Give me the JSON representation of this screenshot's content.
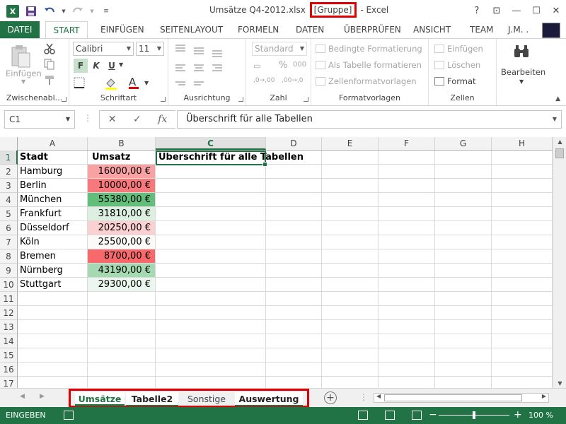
{
  "window": {
    "filename": "Umsätze Q4-2012.xlsx",
    "group_tag": "[Gruppe]",
    "app_suffix": "- Excel",
    "help": "?",
    "restore": "⊡",
    "minimize": "—",
    "maximize": "☐",
    "close": "✕"
  },
  "ribbon_tabs": [
    "DATEI",
    "START",
    "EINFÜGEN",
    "SEITENLAYOUT",
    "FORMELN",
    "DATEN",
    "ÜBERPRÜFEN",
    "ANSICHT",
    "TEAM"
  ],
  "user_name": "J.M. .",
  "clipboard": {
    "label": "Zwischenabl...",
    "paste": "Einfügen"
  },
  "font": {
    "label": "Schriftart",
    "name": "Calibri",
    "size": "11",
    "bold": "F",
    "italic": "K",
    "underline": "U"
  },
  "alignment": {
    "label": "Ausrichtung"
  },
  "number": {
    "label": "Zahl",
    "format": "Standard",
    "percent": "%",
    "thousands": "000"
  },
  "styles": {
    "label": "Formatvorlagen",
    "conditional": "Bedingte Formatierung",
    "as_table": "Als Tabelle formatieren",
    "cell_styles": "Zellenformatvorlagen"
  },
  "cells_group": {
    "label": "Zellen",
    "insert": "Einfügen",
    "delete": "Löschen",
    "format": "Format"
  },
  "editing": {
    "label": "Bearbeiten"
  },
  "formula_bar": {
    "name_box": "C1",
    "cancel": "✕",
    "enter": "✓",
    "fx": "fx",
    "content": "Überschrift für alle Tabellen"
  },
  "columns": [
    "A",
    "B",
    "C",
    "D",
    "E",
    "F",
    "G",
    "H"
  ],
  "rows": [
    "1",
    "2",
    "3",
    "4",
    "5",
    "6",
    "7",
    "8",
    "9",
    "10",
    "11",
    "12",
    "13",
    "14",
    "15",
    "16",
    "17"
  ],
  "header_cells": {
    "a1": "Stadt",
    "b1": "Umsatz",
    "c1": "Überschrift für alle Tabellen"
  },
  "data_rows": [
    {
      "city": "Hamburg",
      "amount": "16000,00 €",
      "color": "#f8a2a4"
    },
    {
      "city": "Berlin",
      "amount": "10000,00 €",
      "color": "#f8797b"
    },
    {
      "city": "München",
      "amount": "55380,00 €",
      "color": "#63be7b"
    },
    {
      "city": "Frankfurt",
      "amount": "31810,00 €",
      "color": "#dcefe1"
    },
    {
      "city": "Düsseldorf",
      "amount": "20250,00 €",
      "color": "#fbd0d1"
    },
    {
      "city": "Köln",
      "amount": "25500,00 €",
      "color": "#fcf9f9"
    },
    {
      "city": "Bremen",
      "amount": "8700,00 €",
      "color": "#f8696b"
    },
    {
      "city": "Nürnberg",
      "amount": "43190,00 €",
      "color": "#a5d9b1"
    },
    {
      "city": "Stuttgart",
      "amount": "29300,00 €",
      "color": "#ebf6ee"
    }
  ],
  "sheets": [
    "Umsätze",
    "Tabelle2",
    "Sonstige",
    "Auswertung"
  ],
  "status": {
    "mode": "EINGEBEN",
    "zoom": "100 %",
    "minus": "−",
    "plus": "+"
  },
  "colors": {
    "accent": "#217346",
    "highlight": "#e00000"
  }
}
